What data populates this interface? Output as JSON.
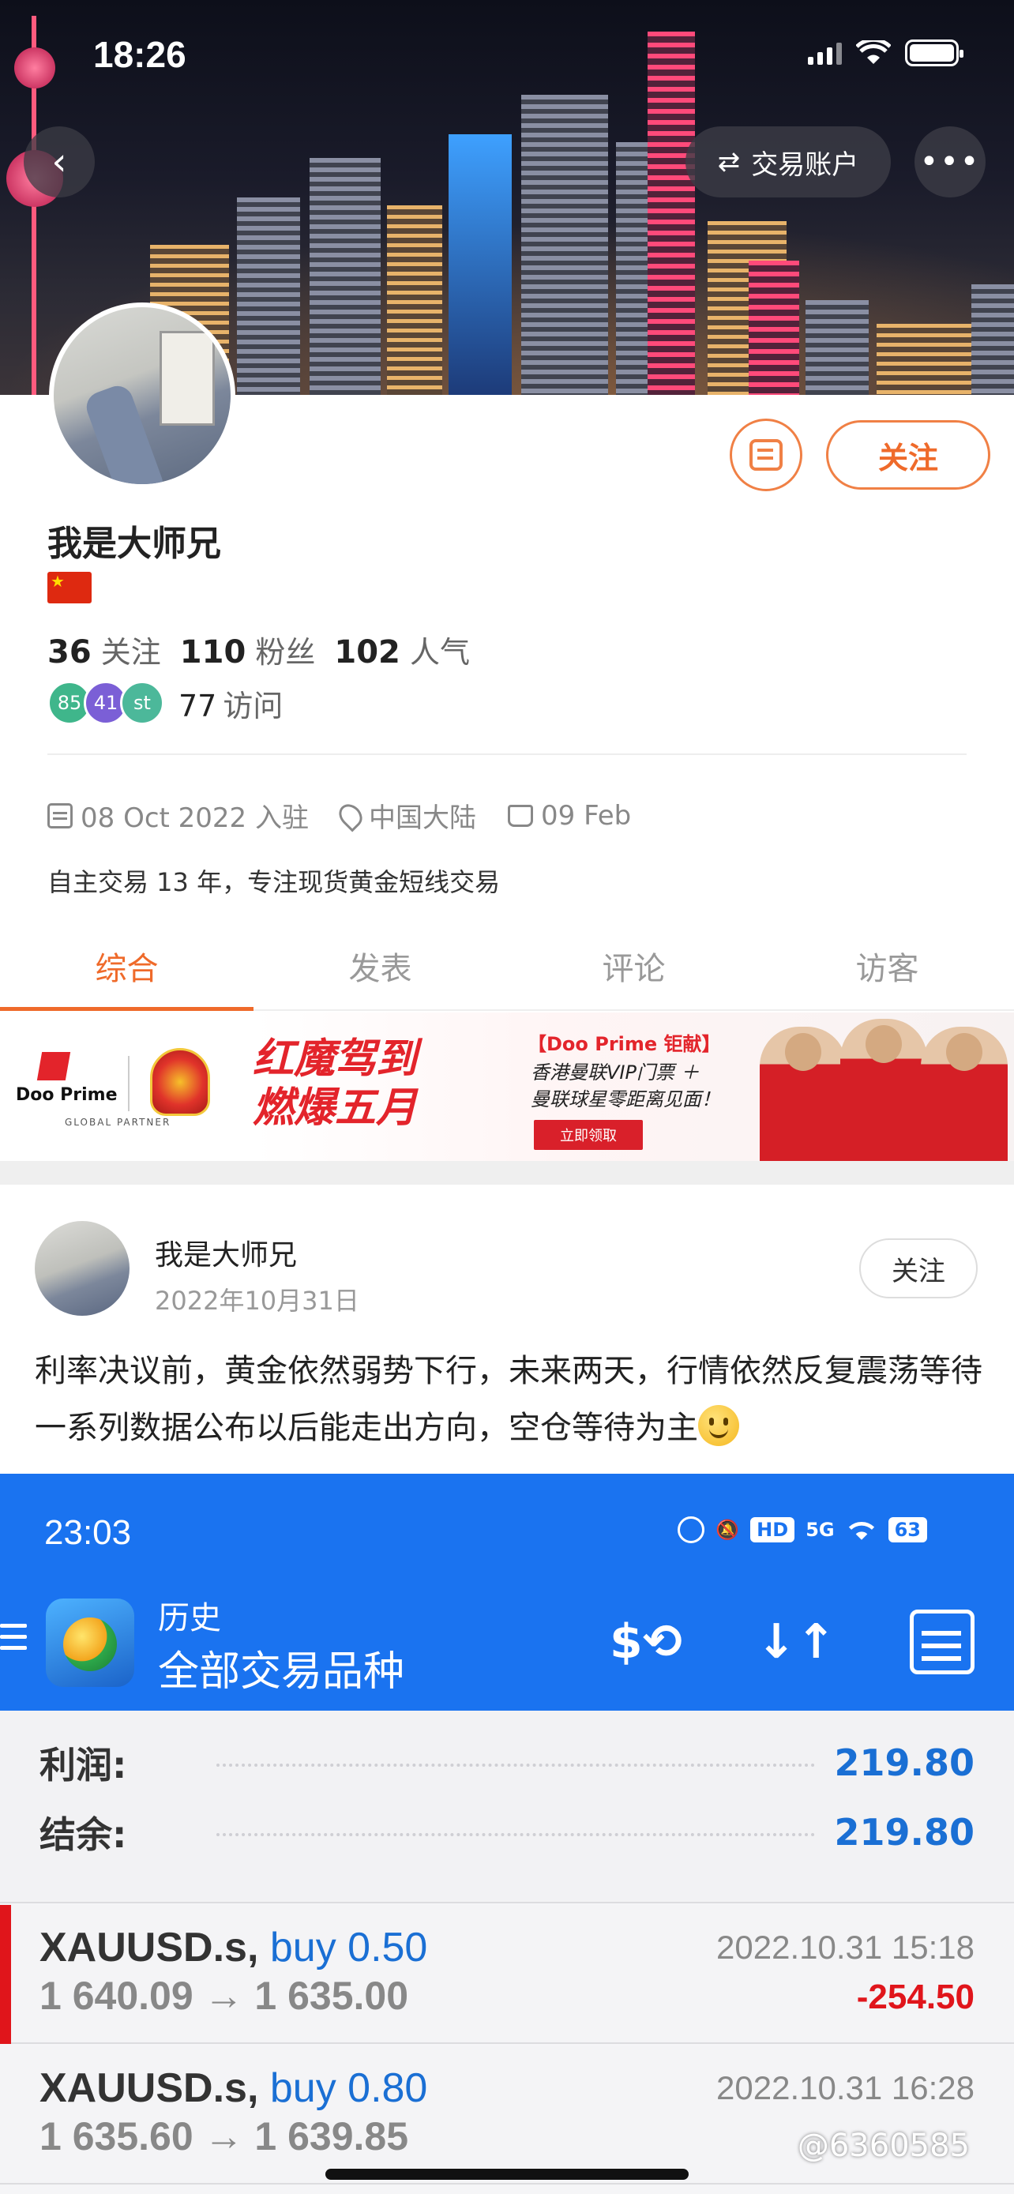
{
  "status_bar": {
    "time": "18:26"
  },
  "header": {
    "account_button": "交易账户"
  },
  "profile": {
    "name": "我是大师兄",
    "follow_button": "关注",
    "stats": [
      {
        "value": "36",
        "label": "关注"
      },
      {
        "value": "110",
        "label": "粉丝"
      },
      {
        "value": "102",
        "label": "人气"
      }
    ],
    "visitor_badges": [
      "85",
      "41",
      "st"
    ],
    "visits": {
      "value": "77",
      "label": "访问"
    },
    "joined": "08 Oct 2022 入驻",
    "location": "中国大陆",
    "birthday": "09 Feb",
    "bio": "自主交易 13 年，专注现货黄金短线交易"
  },
  "tabs": [
    {
      "label": "综合",
      "active": true
    },
    {
      "label": "发表",
      "active": false
    },
    {
      "label": "评论",
      "active": false
    },
    {
      "label": "访客",
      "active": false
    }
  ],
  "banner": {
    "brand": "Doo Prime",
    "brand_sub": "GLOBAL PARTNER",
    "headline_1": "红魔驾到",
    "headline_2": "燃爆五月",
    "tag": "【Doo Prime 钜献】",
    "line_1": "香港曼联VIP门票 ＋",
    "line_2": "曼联球星零距离见面！",
    "cta": "立即领取"
  },
  "post": {
    "author": "我是大师兄",
    "date": "2022年10月31日",
    "follow_button": "关注",
    "text": "利率决议前，黄金依然弱势下行，未来两天，行情依然反复震荡等待一系列数据公布以后能走出方向，空仓等待为主"
  },
  "embedded_screenshot": {
    "time": "23:03",
    "battery": "63",
    "network": "5G",
    "hd": "HD",
    "title_small": "历史",
    "title_large": "全部交易品种",
    "summary": [
      {
        "label": "利润:",
        "value": "219.80"
      },
      {
        "label": "结余:",
        "value": "219.80"
      }
    ],
    "trades": [
      {
        "symbol": "XAUUSD.s,",
        "side": "buy 0.50",
        "price": "1 640.09 → 1 635.00",
        "time": "2022.10.31 15:18",
        "pl": "-254.50"
      },
      {
        "symbol": "XAUUSD.s,",
        "side": "buy 0.80",
        "price": "1 635.60 → 1 639.85",
        "time": "2022.10.31 16:28",
        "pl": ""
      }
    ]
  },
  "watermark": "@6360585",
  "colors": {
    "accent": "#ef6a2a",
    "mt_blue": "#1a73f0",
    "loss_red": "#e0151b",
    "value_blue": "#1a6fd4"
  }
}
